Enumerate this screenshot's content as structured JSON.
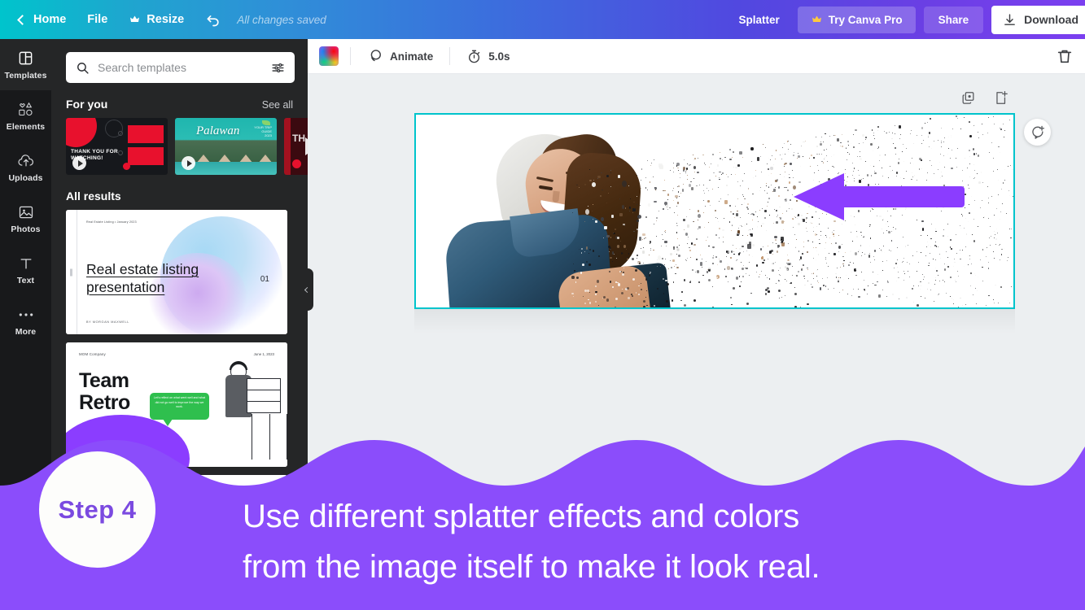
{
  "topbar": {
    "back_icon": "chevron-left-icon",
    "home": "Home",
    "file": "File",
    "resize": "Resize",
    "resize_icon": "crown-icon",
    "undo_icon": "undo-arrow-icon",
    "saved_status": "All changes saved",
    "doc_title": "Splatter",
    "try_pro": "Try Canva Pro",
    "try_pro_icon": "crown-icon",
    "share": "Share",
    "download": "Download",
    "download_icon": "download-icon",
    "gradient_start": "#00c4cc",
    "gradient_end": "#7b3ff0"
  },
  "rail": {
    "items": [
      {
        "label": "Templates",
        "icon": "templates-grid-icon",
        "active": true
      },
      {
        "label": "Elements",
        "icon": "shapes-icon",
        "active": false
      },
      {
        "label": "Uploads",
        "icon": "cloud-upload-icon",
        "active": false
      },
      {
        "label": "Photos",
        "icon": "image-icon",
        "active": false
      },
      {
        "label": "Text",
        "icon": "text-t-icon",
        "active": false
      },
      {
        "label": "More",
        "icon": "ellipsis-icon",
        "active": false
      }
    ]
  },
  "panel": {
    "search": {
      "placeholder": "Search templates",
      "value": "",
      "search_icon": "search-icon",
      "filter_icon": "sliders-filter-icon"
    },
    "for_you": {
      "title": "For you",
      "see_all": "See all",
      "thumbs": [
        {
          "name": "thank-you-for-watching",
          "line1": "THANK YOU FOR",
          "line2": "WATCHING!"
        },
        {
          "name": "palawan-travel",
          "title": "Palawan",
          "caption": "YOUR TRIP\nGUIDE\n2023"
        },
        {
          "name": "red-intro",
          "title": "TH"
        }
      ]
    },
    "all_results": {
      "title": "All results",
      "cards": [
        {
          "name": "real-estate-listing-presentation",
          "eyebrow": "Real Estate Listing • January 2023",
          "title": "Real estate listing presentation",
          "number": "01",
          "byline": "BY MORGAN MAXWELL"
        },
        {
          "name": "team-retro",
          "company": "MOM Company",
          "date": "June 1, 2023",
          "title": "Team Retro",
          "bubble": "Let's reflect on what went well and what did not go well to improve the way we work."
        }
      ]
    },
    "collapse_icon": "chevron-left-icon"
  },
  "editor_toolbar": {
    "color_swatch": "rainbow-color-swatch",
    "animate": "Animate",
    "animate_icon": "animate-circles-icon",
    "duration": "5.0s",
    "duration_icon": "stopwatch-icon",
    "trash_icon": "trash-icon"
  },
  "canvas": {
    "duplicate_icon": "duplicate-page-icon",
    "add_page_icon": "add-page-icon",
    "comment_icon": "add-comment-icon",
    "selection_color": "#00c4cc",
    "arrow": {
      "name": "purple-left-arrow",
      "color": "#8b3dff",
      "direction": "left"
    },
    "photo": {
      "name": "woman-dispersion-splatter-photo",
      "description": "Smiling woman in denim jacket and grey hoodie with splatter dispersion effect"
    }
  },
  "banner": {
    "color": "#8b4dfb",
    "step_label": "Step 4",
    "step_text_color": "#7b4ae0",
    "line1": "Use different splatter effects and colors",
    "line2": "from the image itself to make it look real."
  }
}
